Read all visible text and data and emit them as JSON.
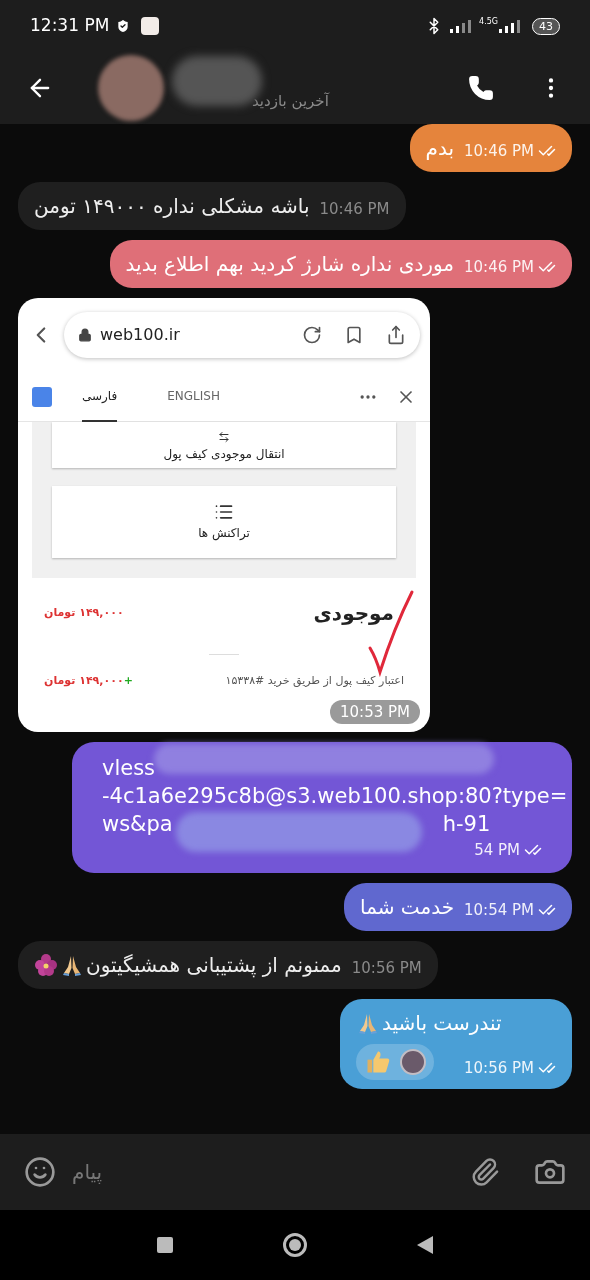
{
  "status_bar": {
    "time": "12:31 PM",
    "network": "4.5G",
    "battery": "43"
  },
  "header": {
    "subtitle": "آخرین بازدید"
  },
  "messages": [
    {
      "kind": "text",
      "outgoing": true,
      "color": "#e5843c",
      "text": "بدم",
      "time": "10:46 PM",
      "read": true
    },
    {
      "kind": "text",
      "outgoing": false,
      "text": "باشه مشکلی نداره ۱۴۹۰۰۰ تومن",
      "time": "10:46 PM"
    },
    {
      "kind": "text",
      "outgoing": true,
      "color": "#df6f78",
      "text": "موردی نداره شارژ کردید بهم اطلاع بدید",
      "time": "10:46 PM",
      "read": true
    },
    {
      "kind": "screenshot",
      "outgoing": false,
      "time": "10:53 PM",
      "screenshot": {
        "url": "web100.ir",
        "tabs": [
          {
            "label": "ENGLISH",
            "selected": false
          },
          {
            "label": "فارسی",
            "selected": true
          }
        ],
        "cards": [
          "انتقال موجودی کیف پول",
          "تراکنش ها"
        ],
        "balance_label": "موجودی",
        "balance": "۱۴۹,۰۰۰ تومان",
        "transaction": {
          "description": "اعتبار کیف پول از طریق خرید #۱۵۳۳۸",
          "amount": "۱۴۹,۰۰۰ تومان",
          "sign": "+"
        }
      }
    },
    {
      "kind": "redacted",
      "outgoing": true,
      "color": "#7356d6",
      "lines": [
        "vless",
        "-4c1a6e295c8b@s3.web100.shop:80?type=",
        "ws&pa"
      ],
      "line_tail": "h-91",
      "time": "54 PM",
      "read": true
    },
    {
      "kind": "text",
      "outgoing": true,
      "color": "#6068cf",
      "text": "خدمت شما",
      "time": "10:54 PM",
      "read": true
    },
    {
      "kind": "text",
      "outgoing": false,
      "text": "ممنونم از پشتیبانی همشیگیتون",
      "time": "10:56 PM"
    },
    {
      "kind": "text",
      "outgoing": true,
      "color": "#4a9fd6",
      "text": "تندرست باشید",
      "time": "10:56 PM",
      "read": true
    }
  ],
  "input": {
    "placeholder": "پیام"
  }
}
